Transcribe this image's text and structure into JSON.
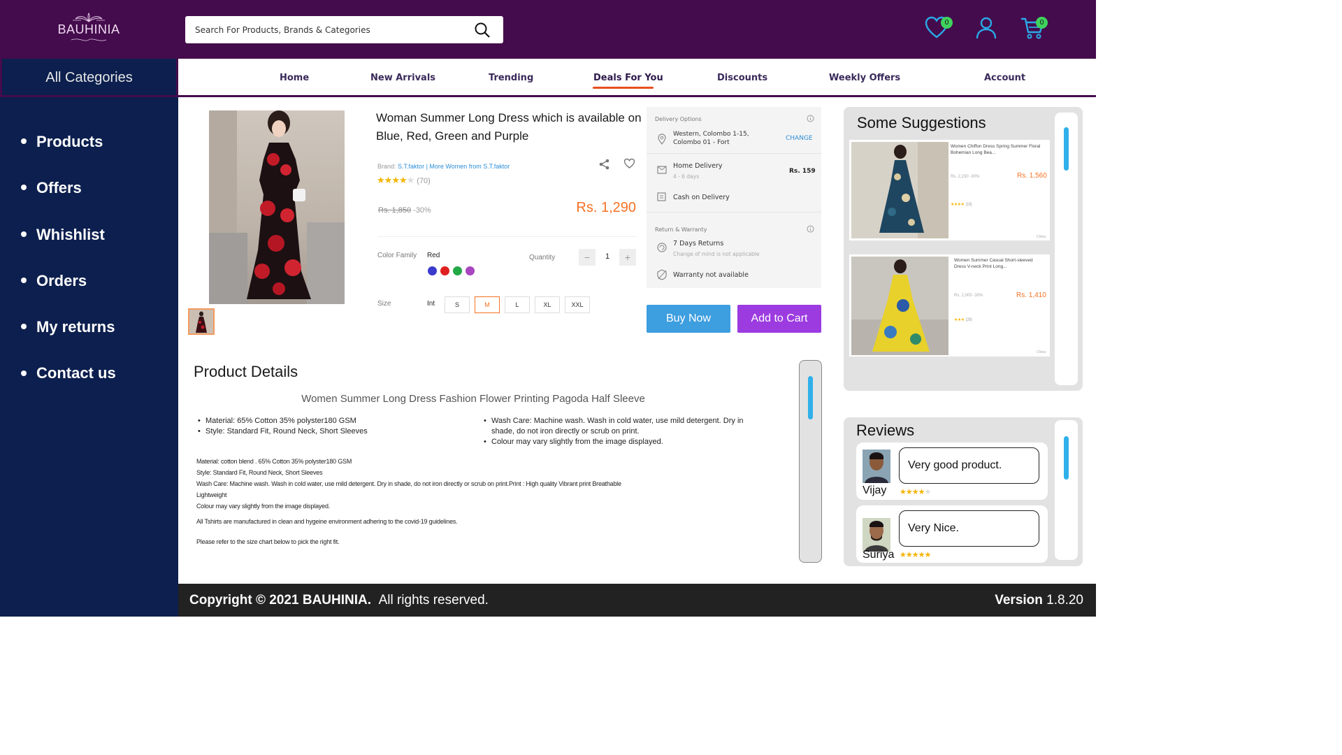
{
  "header": {
    "logo_text": "BAUHINIA",
    "search_placeholder": "Search For Products, Brands & Categories",
    "wishlist_count": "0",
    "cart_count": "0"
  },
  "categories_title": "All Categories",
  "nav": {
    "items": [
      "Home",
      "New Arrivals",
      "Trending",
      "Deals For You",
      "Discounts",
      "Weekly Offers",
      "Account"
    ],
    "active": "Deals For You",
    "accent": "#e84f1e"
  },
  "sidebar": {
    "items": [
      "Products",
      "Offers",
      "Whishlist",
      "Orders",
      "My returns",
      "Contact us"
    ]
  },
  "product": {
    "title": "Woman Summer Long Dress which is available on Blue, Red, Green and Purple",
    "brand_label": "Brand:",
    "brand": "S.T.faktor",
    "more_from": "| More Women from S.T.faktor",
    "rating": 4,
    "rating_count": "(70)",
    "old_price": "Rs. 1,850",
    "discount": "-30%",
    "price": "Rs. 1,290",
    "color_label": "Color Family",
    "color_value": "Red",
    "swatches": [
      "#3a3acb",
      "#e02020",
      "#22a845",
      "#a845c0"
    ],
    "quantity_label": "Quantity",
    "quantity": "1",
    "qty_minus": "−",
    "qty_plus": "+",
    "size_label": "Size",
    "size_system": "Int",
    "sizes": [
      "S",
      "M",
      "L",
      "XL",
      "XXL"
    ],
    "selected_size": "M"
  },
  "delivery": {
    "title": "Delivery Options",
    "address": "Western, Colombo 1-15, Colombo 01 - Fort",
    "change": "CHANGE",
    "home_delivery": "Home Delivery",
    "home_days": "4 - 6 days",
    "home_price": "Rs. 159",
    "cod": "Cash on Delivery",
    "return_title": "Return & Warranty",
    "returns": "7 Days Returns",
    "returns_note": "Change of mind is not applicable",
    "warranty": "Warranty not available"
  },
  "actions": {
    "buy_now": "Buy Now",
    "add_to_cart": "Add to Cart"
  },
  "details": {
    "heading": "Product Details",
    "subtitle": "Women Summer Long Dress Fashion Flower Printing Pagoda Half Sleeve",
    "left_bullets": [
      "Material: 65% Cotton 35% polyster180 GSM",
      "Style: Standard Fit, Round Neck, Short Sleeves"
    ],
    "right_bullets": [
      "Wash Care: Machine wash. Wash in cold water, use mild detergent. Dry in shade, do not iron directly or scrub on print.",
      "Colour may vary slightly from the image displayed."
    ],
    "lines": [
      "Material: cotton blend . 65% Cotton 35% polyster180 GSM",
      "Style: Standard Fit, Round Neck, Short Sleeves",
      "Wash Care: Machine wash. Wash in cold water, use mild detergent. Dry in shade, do not iron directly or scrub on print.Print : High quality Vibrant print Breathable",
      "Lightweight",
      "Colour may vary slightly from the image displayed."
    ],
    "note1": "All Tshirts are manufactured in clean and hygeine environment adhering to the covid-19 guidelines.",
    "note2": "Please refer to the size chart below to pick the right fit."
  },
  "suggestions": {
    "heading": "Some Suggestions",
    "items": [
      {
        "title": "Women Chiffon Dress Spring Summer Floral Bohemian Long Bea...",
        "old": "Rs. 2,230 -30%",
        "price": "Rs. 1,560",
        "stars": "★★★★",
        "count": "(19)",
        "origin": "China"
      },
      {
        "title": "Women Summer Casual Short-sleeved Dress V-neck Print Long...",
        "old": "Rs. 2,000 -30%",
        "price": "Rs. 1,410",
        "stars": "★★★",
        "count": "(29)",
        "origin": "China"
      }
    ]
  },
  "reviews": {
    "heading": "Reviews",
    "items": [
      {
        "name": "Vijay",
        "text": "Very good product.",
        "rating": 4
      },
      {
        "name": "Suriya",
        "text": "Very Nice.",
        "rating": 5
      }
    ]
  },
  "footer": {
    "copyright": "Copyright",
    "symbol": "©",
    "year": "2021",
    "brand": "BAUHINIA.",
    "rights": "All rights reserved.",
    "version_label": "Version",
    "version": "1.8.20"
  }
}
